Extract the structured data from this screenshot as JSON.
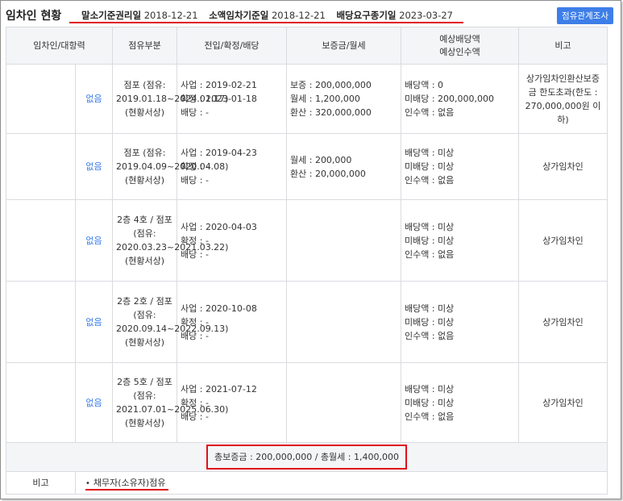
{
  "header": {
    "title": "임차인 현황",
    "dates": [
      {
        "label": "말소기준권리일",
        "value": "2018-12-21"
      },
      {
        "label": "소액임차기준일",
        "value": "2018-12-21"
      },
      {
        "label": "배당요구종기일",
        "value": "2023-03-27"
      }
    ],
    "button_label": "점유관계조사"
  },
  "columns": [
    "임차인/대항력",
    "점유부분",
    "전입/확정/배당",
    "보증금/월세",
    "예상배당액\n예상인수액",
    "비고"
  ],
  "rows": [
    {
      "force": "없음",
      "part": "점포 (점유: 2019.01.18~2024.01.17) (현황서상)",
      "moves": [
        "사업 : 2019-02-21",
        "확정 : 2023-01-18",
        "배당 : -"
      ],
      "deposit": [
        "보증 : 200,000,000",
        "월세 : 1,200,000",
        "환산 : 320,000,000"
      ],
      "dividend": [
        "배당액 : 0",
        "미배당 : 200,000,000",
        "인수액 : 없음"
      ],
      "note": "상가임차인환산보증금 한도초과(한도 : 270,000,000원 이하)"
    },
    {
      "force": "없음",
      "part": "점포 (점유: 2019.04.09~2020.04.08) (현황서상)",
      "moves": [
        "사업 : 2019-04-23",
        "확정 : -",
        "배당 : -"
      ],
      "deposit": [
        "월세 : 200,000",
        "환산 : 20,000,000"
      ],
      "dividend": [
        "배당액 : 미상",
        "미배당 : 미상",
        "인수액 : 없음"
      ],
      "note": "상가임차인"
    },
    {
      "force": "없음",
      "part": "2층 4호 / 점포 (점유: 2020.03.23~2021.03.22) (현황서상)",
      "moves": [
        "사업 : 2020-04-03",
        "확정 : -",
        "배당 : -"
      ],
      "deposit": [],
      "dividend": [
        "배당액 : 미상",
        "미배당 : 미상",
        "인수액 : 없음"
      ],
      "note": "상가임차인"
    },
    {
      "force": "없음",
      "part": "2층 2호 / 점포 (점유: 2020.09.14~2022.09.13) (현황서상)",
      "moves": [
        "사업 : 2020-10-08",
        "확정 : -",
        "배당 : -"
      ],
      "deposit": [],
      "dividend": [
        "배당액 : 미상",
        "미배당 : 미상",
        "인수액 : 없음"
      ],
      "note": "상가임차인"
    },
    {
      "force": "없음",
      "part": "2층 5호 / 점포 (점유: 2021.07.01~2025.06.30) (현황서상)",
      "moves": [
        "사업 : 2021-07-12",
        "확정 : -",
        "배당 : -"
      ],
      "deposit": [],
      "dividend": [
        "배당액 : 미상",
        "미배당 : 미상",
        "인수액 : 없음"
      ],
      "note": "상가임차인"
    }
  ],
  "total": "총보증금 : 200,000,000  /  총월세 : 1,400,000",
  "remark": {
    "label": "비고",
    "value": "채무자(소유자)점유"
  },
  "colors": {
    "accent_blue": "#3d7ee8",
    "highlight_red": "#e0101a",
    "header_bg": "#f4f5f7",
    "border": "#d9dbe0"
  }
}
